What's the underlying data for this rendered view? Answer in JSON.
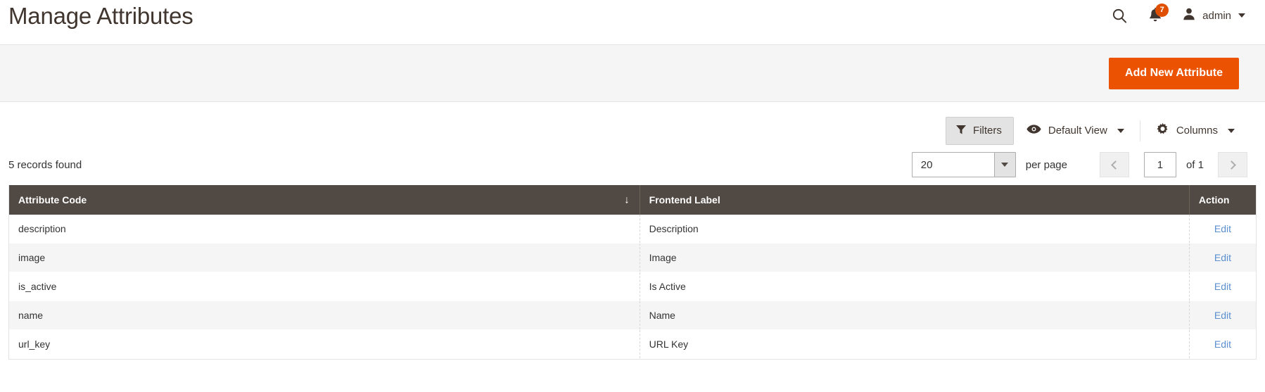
{
  "header": {
    "title": "Manage Attributes",
    "search_icon": "search-icon",
    "notifications": {
      "icon": "bell-icon",
      "badge_count": "7"
    },
    "user": {
      "icon": "user-avatar-icon",
      "name": "admin",
      "caret": "chevron-down-icon"
    }
  },
  "action_bar": {
    "add_new_attribute_label": "Add New Attribute"
  },
  "grid_toolbar": {
    "filters_label": "Filters",
    "view_label": "Default View",
    "columns_label": "Columns"
  },
  "grid_head": {
    "records_found": "5 records found",
    "per_page_value": "20",
    "per_page_label": "per page",
    "page_value": "1",
    "page_of": "of 1"
  },
  "table": {
    "columns": [
      {
        "label": "Attribute Code",
        "sort_indicator": "↓"
      },
      {
        "label": "Frontend Label",
        "sort_indicator": ""
      },
      {
        "label": "Action",
        "sort_indicator": ""
      }
    ],
    "rows": [
      {
        "attribute_code": "description",
        "frontend_label": "Description",
        "action": "Edit"
      },
      {
        "attribute_code": "image",
        "frontend_label": "Image",
        "action": "Edit"
      },
      {
        "attribute_code": "is_active",
        "frontend_label": "Is Active",
        "action": "Edit"
      },
      {
        "attribute_code": "name",
        "frontend_label": "Name",
        "action": "Edit"
      },
      {
        "attribute_code": "url_key",
        "frontend_label": "URL Key",
        "action": "Edit"
      }
    ]
  },
  "colors": {
    "accent_orange": "#eb5202",
    "badge_red": "#e04f00",
    "table_header": "#514943",
    "link_blue": "#5a8fd0",
    "row_stripe": "#f5f5f5"
  }
}
